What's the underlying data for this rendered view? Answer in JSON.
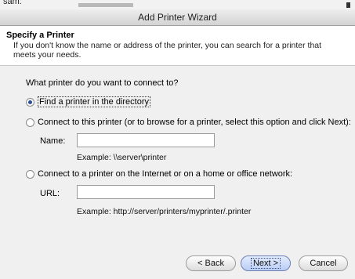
{
  "topstrip": {
    "partial_text": "sam:"
  },
  "window": {
    "title": "Add Printer Wizard"
  },
  "header": {
    "title": "Specify a Printer",
    "description": "If you don't know the name or address of the printer, you can search for a printer that meets your needs."
  },
  "body": {
    "question": "What printer do you want to connect to?",
    "options": [
      {
        "label": "Find a printer in the directory",
        "selected": true
      },
      {
        "label": "Connect to this printer (or to browse for a printer, select this option and click Next):",
        "selected": false
      },
      {
        "label": "Connect to a printer on the Internet or on a home or office network:",
        "selected": false
      }
    ],
    "name_field": {
      "label": "Name:",
      "value": "",
      "example": "Example: \\\\server\\printer"
    },
    "url_field": {
      "label": "URL:",
      "value": "",
      "example": "Example: http://server/printers/myprinter/.printer"
    }
  },
  "buttons": {
    "back": "< Back",
    "next": "Next >",
    "cancel": "Cancel"
  }
}
